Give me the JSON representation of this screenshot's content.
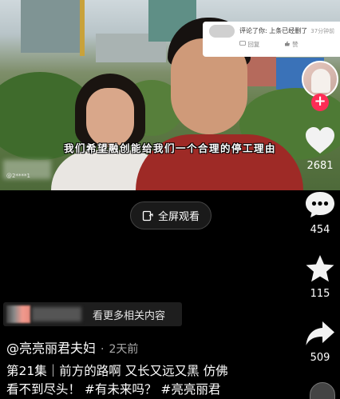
{
  "video": {
    "subtitle": "我们希望融创能给我们一个合理的停工理由",
    "watermark": "@2****1"
  },
  "comment_popup": {
    "text": "评论了你: 上条已经删了",
    "time": "37分钟前",
    "reply_label": "回复",
    "like_label": "赞"
  },
  "sidebar": {
    "follow_symbol": "+",
    "likes": "2681",
    "comments": "454",
    "favorites": "115",
    "shares": "509"
  },
  "fullscreen": {
    "label": "全屏观看"
  },
  "related": {
    "label": "看更多相关内容"
  },
  "post": {
    "author": "@亮亮丽君夫妇",
    "time": "2天前",
    "caption_line1": "第21集｜前方的路啊 又长又远又黑 仿佛",
    "caption_line2": "看不到尽头！ #有未来吗？ #亮亮丽君"
  },
  "colors": {
    "background": "#000000",
    "follow_badge": "#fe2c55",
    "shirt": "#9e2a26"
  }
}
